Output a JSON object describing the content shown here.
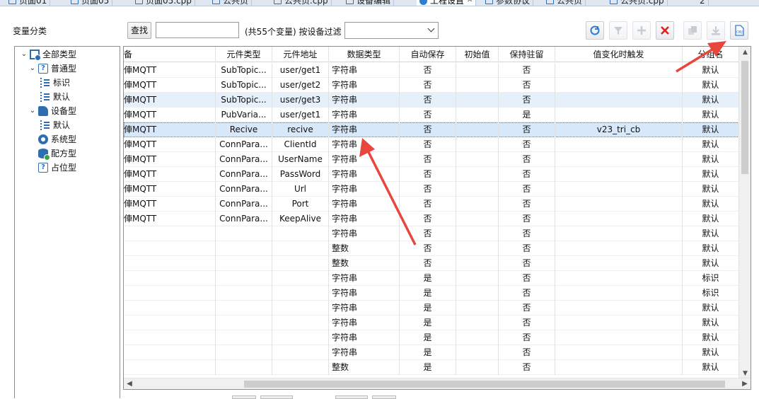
{
  "tabs": [
    {
      "label": "页面01",
      "icon": "page-icon",
      "active": false
    },
    {
      "label": "页面05",
      "icon": "page-icon",
      "active": false
    },
    {
      "label": "页面05.cpp",
      "icon": "page-icon",
      "active": false
    },
    {
      "label": "公共页",
      "icon": "page-icon",
      "active": false
    },
    {
      "label": "公共页.cpp",
      "icon": "page-icon",
      "active": false
    },
    {
      "label": "设备编辑",
      "icon": "page-icon",
      "active": false
    },
    {
      "label": "工程设置",
      "icon": "gear-icon",
      "active": true
    },
    {
      "label": "参数协议",
      "icon": "page-icon",
      "active": false
    },
    {
      "label": "公共页",
      "icon": "page-icon",
      "active": false
    },
    {
      "label": "公共页.cpp",
      "icon": "page-icon",
      "active": false
    },
    {
      "label": "2",
      "icon": "",
      "active": false
    }
  ],
  "panel": {
    "category_label": "变量分类",
    "find_button": "查找",
    "search_value": "",
    "count_label": "(共55个变量) 按设备过滤",
    "filter_value": ""
  },
  "toolbar": [
    {
      "name": "refresh-button",
      "icon": "refresh-icon",
      "enabled": true
    },
    {
      "name": "filter-button",
      "icon": "filter-icon",
      "enabled": false
    },
    {
      "name": "add-button",
      "icon": "plus-icon",
      "enabled": false
    },
    {
      "name": "delete-button",
      "icon": "close-icon",
      "enabled": true
    },
    {
      "name": "copy-button",
      "icon": "copy-icon",
      "enabled": false
    },
    {
      "name": "export-button",
      "icon": "download-icon",
      "enabled": false
    },
    {
      "name": "obj-button",
      "icon": "obj-file-icon",
      "enabled": true
    }
  ],
  "tree": [
    {
      "label": "全部类型",
      "level": 0,
      "expanded": true,
      "icon": "root-type-icon"
    },
    {
      "label": "普通型",
      "level": 1,
      "expanded": true,
      "icon": "question-icon"
    },
    {
      "label": "标识",
      "level": 2,
      "icon": "tag-icon"
    },
    {
      "label": "默认",
      "level": 2,
      "icon": "tag-icon"
    },
    {
      "label": "设备型",
      "level": 1,
      "expanded": true,
      "icon": "device-icon"
    },
    {
      "label": "默认",
      "level": 2,
      "icon": "tag-icon"
    },
    {
      "label": "系统型",
      "level": 1,
      "icon": "system-icon"
    },
    {
      "label": "配方型",
      "level": 1,
      "icon": "recipe-icon"
    },
    {
      "label": "占位型",
      "level": 1,
      "icon": "question-icon"
    }
  ],
  "grid": {
    "columns": [
      "备",
      "元件类型",
      "元件地址",
      "数据类型",
      "自动保存",
      "初始值",
      "保持驻留",
      "值变化时触发",
      "分组名"
    ],
    "rows": [
      [
        "俥MQTT",
        "SubTopic...",
        "user/get1",
        "字符串",
        "否",
        "",
        "否",
        "",
        "默认"
      ],
      [
        "俥MQTT",
        "SubTopic...",
        "user/get2",
        "字符串",
        "否",
        "",
        "否",
        "",
        "默认"
      ],
      [
        "俥MQTT",
        "SubTopic...",
        "user/get3",
        "字符串",
        "否",
        "",
        "否",
        "",
        "默认"
      ],
      [
        "俥MQTT",
        "PubVaria...",
        "user/get1",
        "字符串",
        "否",
        "",
        "是",
        "",
        "默认"
      ],
      [
        "俥MQTT",
        "Recive",
        "recive",
        "字符串",
        "否",
        "",
        "否",
        "v23_tri_cb",
        "默认"
      ],
      [
        "俥MQTT",
        "ConnPara...",
        "ClientId",
        "字符串",
        "否",
        "",
        "否",
        "",
        "默认"
      ],
      [
        "俥MQTT",
        "ConnPara...",
        "UserName",
        "字符串",
        "否",
        "",
        "否",
        "",
        "默认"
      ],
      [
        "俥MQTT",
        "ConnPara...",
        "PassWord",
        "字符串",
        "否",
        "",
        "否",
        "",
        "默认"
      ],
      [
        "俥MQTT",
        "ConnPara...",
        "Url",
        "字符串",
        "否",
        "",
        "否",
        "",
        "默认"
      ],
      [
        "俥MQTT",
        "ConnPara...",
        "Port",
        "字符串",
        "否",
        "",
        "否",
        "",
        "默认"
      ],
      [
        "俥MQTT",
        "ConnPara...",
        "KeepAlive",
        "字符串",
        "否",
        "",
        "否",
        "",
        "默认"
      ],
      [
        "",
        "",
        "",
        "字符串",
        "否",
        "",
        "否",
        "",
        "默认"
      ],
      [
        "",
        "",
        "",
        "整数",
        "否",
        "",
        "否",
        "",
        "默认"
      ],
      [
        "",
        "",
        "",
        "整数",
        "否",
        "",
        "否",
        "",
        "默认"
      ],
      [
        "",
        "",
        "",
        "字符串",
        "是",
        "",
        "否",
        "",
        "标识"
      ],
      [
        "",
        "",
        "",
        "字符串",
        "是",
        "",
        "否",
        "",
        "标识"
      ],
      [
        "",
        "",
        "",
        "字符串",
        "是",
        "",
        "否",
        "",
        "默认"
      ],
      [
        "",
        "",
        "",
        "字符串",
        "是",
        "",
        "否",
        "",
        "默认"
      ],
      [
        "",
        "",
        "",
        "字符串",
        "是",
        "",
        "否",
        "",
        "默认"
      ],
      [
        "",
        "",
        "",
        "字符串",
        "是",
        "",
        "否",
        "",
        "默认"
      ],
      [
        "",
        "",
        "",
        "整数",
        "是",
        "",
        "否",
        "",
        "默认"
      ]
    ],
    "selected_row": 4,
    "highlight_row": 2
  },
  "colors": {
    "accent": "#2f6db3",
    "selection": "#d7e8fb",
    "annotation_arrow": "#e8453c",
    "delete_red": "#e02020"
  }
}
